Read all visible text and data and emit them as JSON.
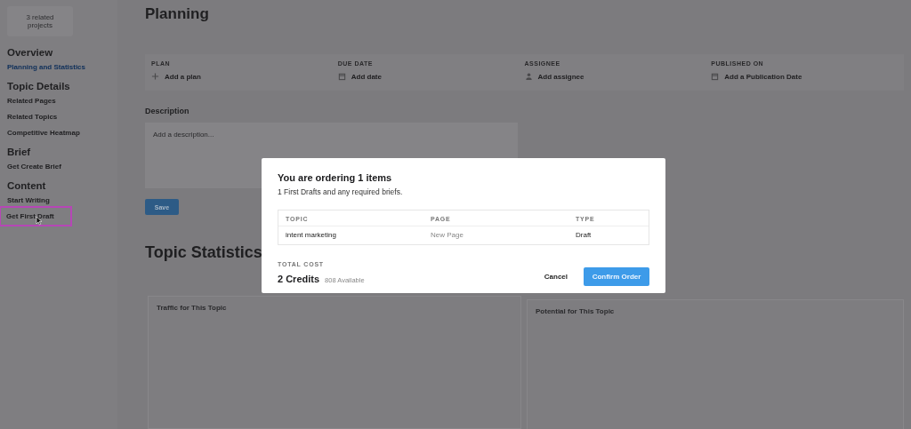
{
  "sidebar": {
    "projects_button": "3 related projects",
    "sections": [
      {
        "title": "Overview",
        "items": [
          {
            "label": "Planning and Statistics",
            "selected": true,
            "highlighted": false
          }
        ]
      },
      {
        "title": "Topic Details",
        "items": [
          {
            "label": "Related Pages",
            "selected": false,
            "highlighted": false
          },
          {
            "label": "Related Topics",
            "selected": false,
            "highlighted": false
          },
          {
            "label": "Competitive Heatmap",
            "selected": false,
            "highlighted": false
          }
        ]
      },
      {
        "title": "Brief",
        "items": [
          {
            "label": "Get Create Brief",
            "selected": false,
            "highlighted": false
          }
        ]
      },
      {
        "title": "Content",
        "items": [
          {
            "label": "Start Writing",
            "selected": false,
            "highlighted": false
          },
          {
            "label": "Get First Draft",
            "selected": false,
            "highlighted": true
          }
        ]
      }
    ]
  },
  "main": {
    "title": "Planning",
    "fields": [
      {
        "label": "PLAN",
        "kind": "plan",
        "value": "Add a plan"
      },
      {
        "label": "DUE DATE",
        "kind": "date",
        "value": "Add date"
      },
      {
        "label": "ASSIGNEE",
        "kind": "person",
        "value": "Add assignee"
      },
      {
        "label": "PUBLISHED ON",
        "kind": "date",
        "value": "Add a Publication Date"
      }
    ],
    "description": {
      "label": "Description",
      "placeholder": "Add a description..."
    },
    "save_button": "Save",
    "statistics_title": "Topic Statistics",
    "charts": [
      {
        "title": "Traffic for This Topic"
      },
      {
        "title": "Potential for This Topic"
      }
    ]
  },
  "dialog": {
    "title": "You are ordering 1 items",
    "subtitle": "1 First Drafts and any required briefs.",
    "columns": [
      "TOPIC",
      "PAGE",
      "TYPE"
    ],
    "rows": [
      {
        "topic": "intent marketing",
        "page": "New Page",
        "type": "Draft"
      }
    ],
    "total_label": "TOTAL COST",
    "total": "2 Credits",
    "available": "808 Available",
    "cancel": "Cancel",
    "confirm": "Confirm Order"
  }
}
